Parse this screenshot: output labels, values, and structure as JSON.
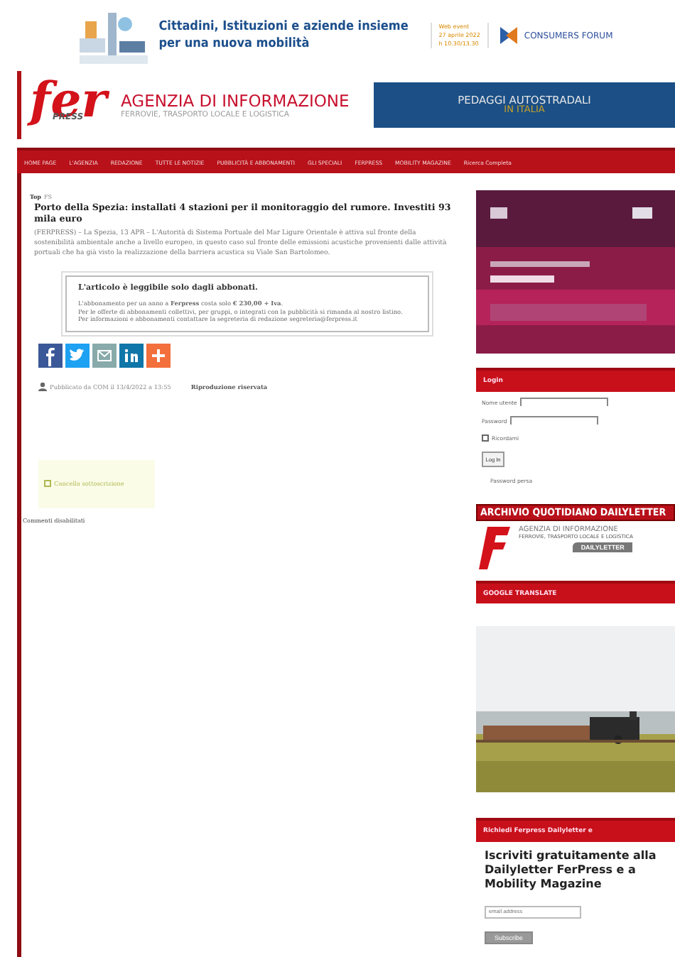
{
  "top_banner": {
    "headline": "Cittadini, Istituzioni e aziende insieme per una nuova mobilità",
    "event": [
      "Web event",
      "27 aprile 2022",
      "h 10.30/13.30"
    ],
    "partner": "CONSUMERS FORUM"
  },
  "header": {
    "logo": "fer",
    "logo_sub": "PRESS",
    "title": "AGENZIA DI INFORMAZIONE",
    "subtitle": "FERROVIE, TRASPORTO LOCALE E LOGISTICA",
    "ad": {
      "line1": "PEDAGGI AUTOSTRADALI",
      "line2": "IN ITALIA"
    }
  },
  "nav": [
    {
      "label": "HOME PAGE"
    },
    {
      "label": "L'AGENZIA"
    },
    {
      "label": "REDAZIONE"
    },
    {
      "label": "TUTTE LE NOTIZIE"
    },
    {
      "label": "PUBBLICITÀ E ABBONAMENTI"
    },
    {
      "label": "GLI SPECIALI"
    },
    {
      "label": "FERPRESS"
    },
    {
      "label": "MOBILITY MAGAZINE"
    },
    {
      "label": "Ricerca Completa"
    }
  ],
  "article": {
    "breadcrumb": [
      "Top",
      "FS"
    ],
    "title": "Porto della Spezia: installati 4 stazioni per il monitoraggio del rumore. Investiti 93 mila euro",
    "body": "(FERPRESS) – La Spezia, 13 APR – L'Autorità di Sistema Portuale del Mar Ligure Orientale è attiva sul fronte della sostenibilità ambientale anche a livello europeo, in questo caso sul fronte delle emissioni acustiche provenienti dalle attività portuali che ha già visto la realizzazione della barriera acustica su Viale San Bartolomeo.",
    "paywall": {
      "heading": "L'articolo è leggibile solo dagli abbonati.",
      "lines": [
        "L'abbonamento per un anno a **Ferpress** costa solo **€ 230,00 + Iva**.",
        "Per le offerte di abbonamenti collettivi, per gruppi, o integrati con la pubblicità si rimanda al nostro listino.",
        "Per informazioni e abbonamenti contattare la segreteria di redazione segreteria@ferpress.it"
      ]
    },
    "share": [
      {
        "kind": "facebook"
      },
      {
        "kind": "twitter"
      },
      {
        "kind": "email"
      },
      {
        "kind": "linkedin"
      },
      {
        "kind": "more"
      }
    ],
    "published": "Pubblicato da COM il 13/4/2022 a 13:55",
    "rights": "Riproduzione riservata",
    "unsubscribe": "Cancella sottoscrizione",
    "comments": "Commenti disabilitati"
  },
  "sidebar": {
    "login": {
      "title": "Login",
      "username_label": "Nome utente",
      "password_label": "Password",
      "remember": "Ricordami",
      "remember_checked": false,
      "button": "Log In",
      "lost": "Password persa"
    },
    "archive": {
      "title": "ARCHIVIO QUOTIDIANO DAILYLETTER",
      "line": "AGENZIA DI INFORMAZIONE",
      "sub": "FERROVIE, TRASPORTO LOCALE E LOGISTICA",
      "badge": "DAILYLETTER"
    },
    "translate": {
      "title": "GOOGLE TRANSLATE"
    },
    "newsletter": {
      "title": "Richiedi Ferpress Dailyletter e",
      "heading": "Iscriviti gratuitamente alla Dailyletter FerPress e a Mobility Magazine",
      "placeholder": "email address",
      "button": "Subscribe"
    }
  }
}
